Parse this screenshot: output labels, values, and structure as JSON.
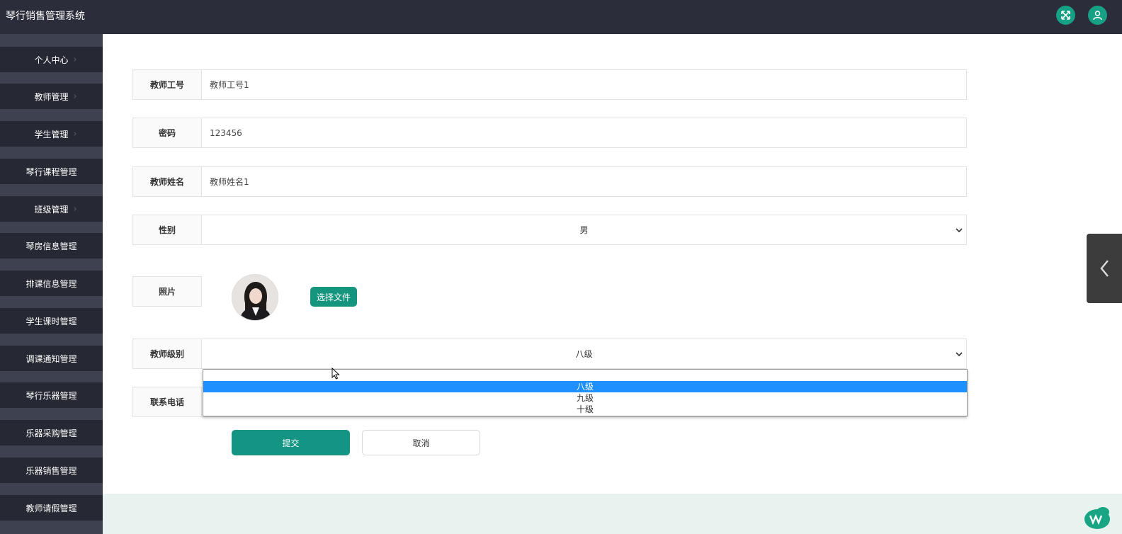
{
  "app": {
    "title": "琴行销售管理系统",
    "accent": "#16a085",
    "header_bg": "#2b2d3a"
  },
  "header_icons": [
    "fullscreen-icon",
    "user-icon"
  ],
  "sidebar": {
    "items": [
      {
        "label": "个人中心"
      },
      {
        "label": "教师管理"
      },
      {
        "label": "学生管理"
      },
      {
        "label": "琴行课程管理"
      },
      {
        "label": "班级管理"
      },
      {
        "label": "琴房信息管理"
      },
      {
        "label": "排课信息管理"
      },
      {
        "label": "学生课时管理"
      },
      {
        "label": "调课通知管理"
      },
      {
        "label": "琴行乐器管理"
      },
      {
        "label": "乐器采购管理"
      },
      {
        "label": "乐器销售管理"
      },
      {
        "label": "教师请假管理"
      }
    ]
  },
  "form": {
    "teacher_no": {
      "label": "教师工号",
      "value": "教师工号1"
    },
    "password": {
      "label": "密码",
      "value": "123456"
    },
    "teacher_name": {
      "label": "教师姓名",
      "value": "教师姓名1"
    },
    "gender": {
      "label": "性别",
      "value": "男"
    },
    "photo": {
      "label": "照片",
      "button": "选择文件"
    },
    "level": {
      "label": "教师级别",
      "value": "八级",
      "options": [
        "",
        "八级",
        "九级",
        "十级"
      ],
      "highlighted": "八级"
    },
    "phone": {
      "label": "联系电话",
      "value": ""
    }
  },
  "actions": {
    "submit": "提交",
    "cancel": "取消"
  }
}
